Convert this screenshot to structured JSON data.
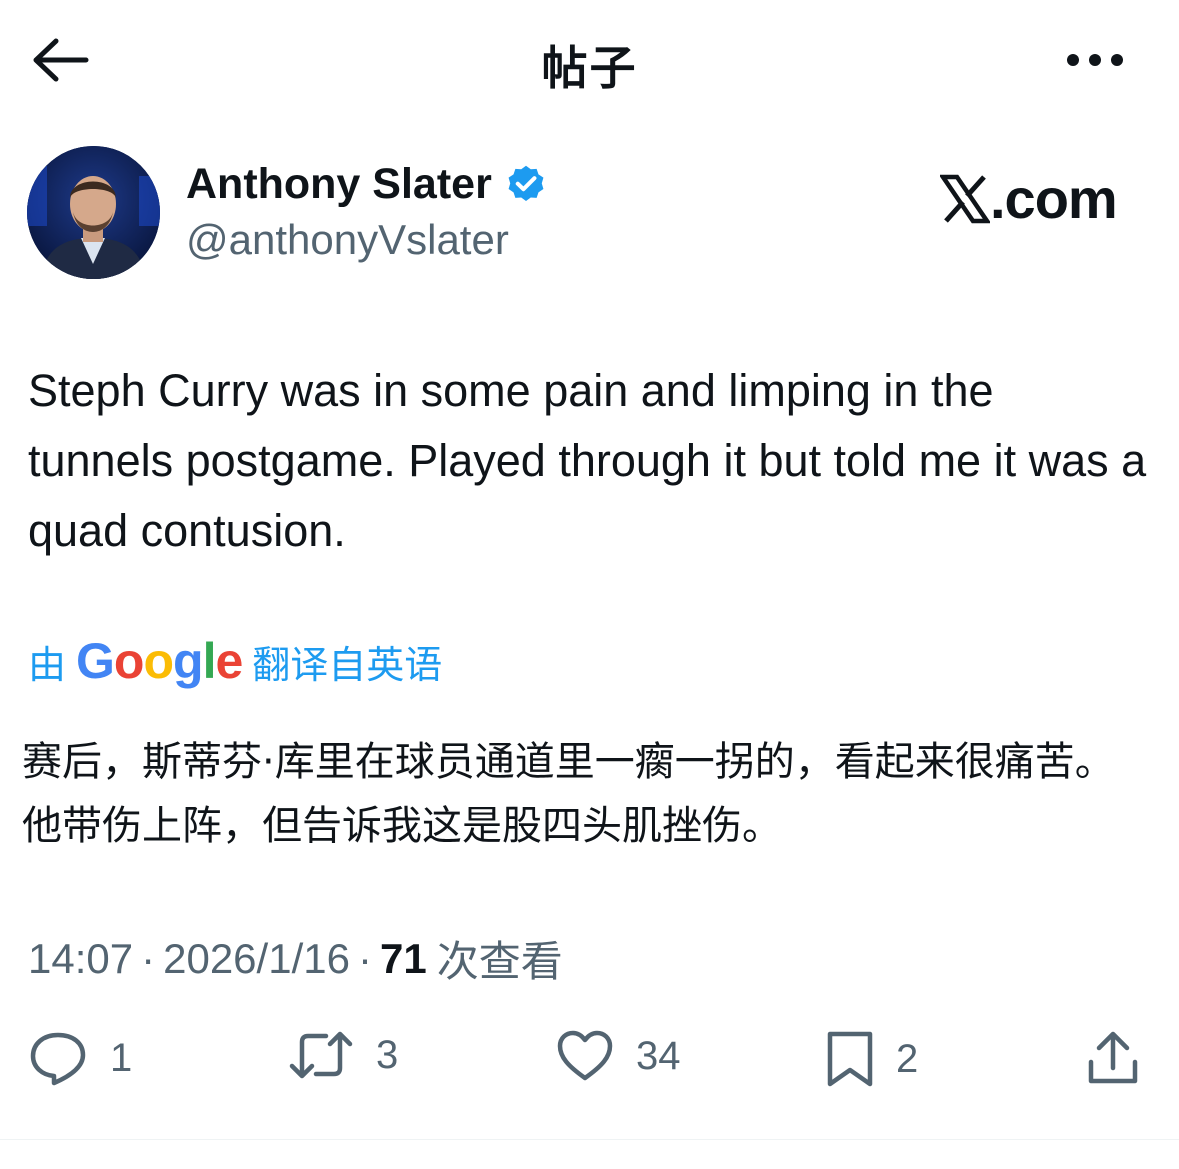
{
  "header": {
    "title": "帖子",
    "back_icon": "arrow-left-icon",
    "more_icon": "more-horizontal-icon"
  },
  "author": {
    "name": "Anthony Slater",
    "handle": "@anthonyVslater",
    "verified": true,
    "verified_color": "#1d9bf0"
  },
  "watermark": {
    "logo_letter": "X",
    "suffix": ".com"
  },
  "tweet": {
    "text": "Steph Curry was in some pain and limping in the tunnels postgame. Played through it but told me it was a quad contusion."
  },
  "translation": {
    "prefix": "由",
    "provider": "Google",
    "suffix": "翻译自英语",
    "text": "赛后，斯蒂芬·库里在球员通道里一瘸一拐的，看起来很痛苦。他带伤上阵，但告诉我这是股四头肌挫伤。",
    "link_color": "#1d9bf0"
  },
  "meta": {
    "time": "14:07",
    "date": "2026/1/16",
    "separator": "·",
    "views_count": "71",
    "views_label": "次查看"
  },
  "actions": {
    "replies": "1",
    "reposts": "3",
    "likes": "34",
    "bookmarks": "2"
  },
  "colors": {
    "text_primary": "#0f1419",
    "text_secondary": "#536471",
    "accent": "#1d9bf0"
  }
}
